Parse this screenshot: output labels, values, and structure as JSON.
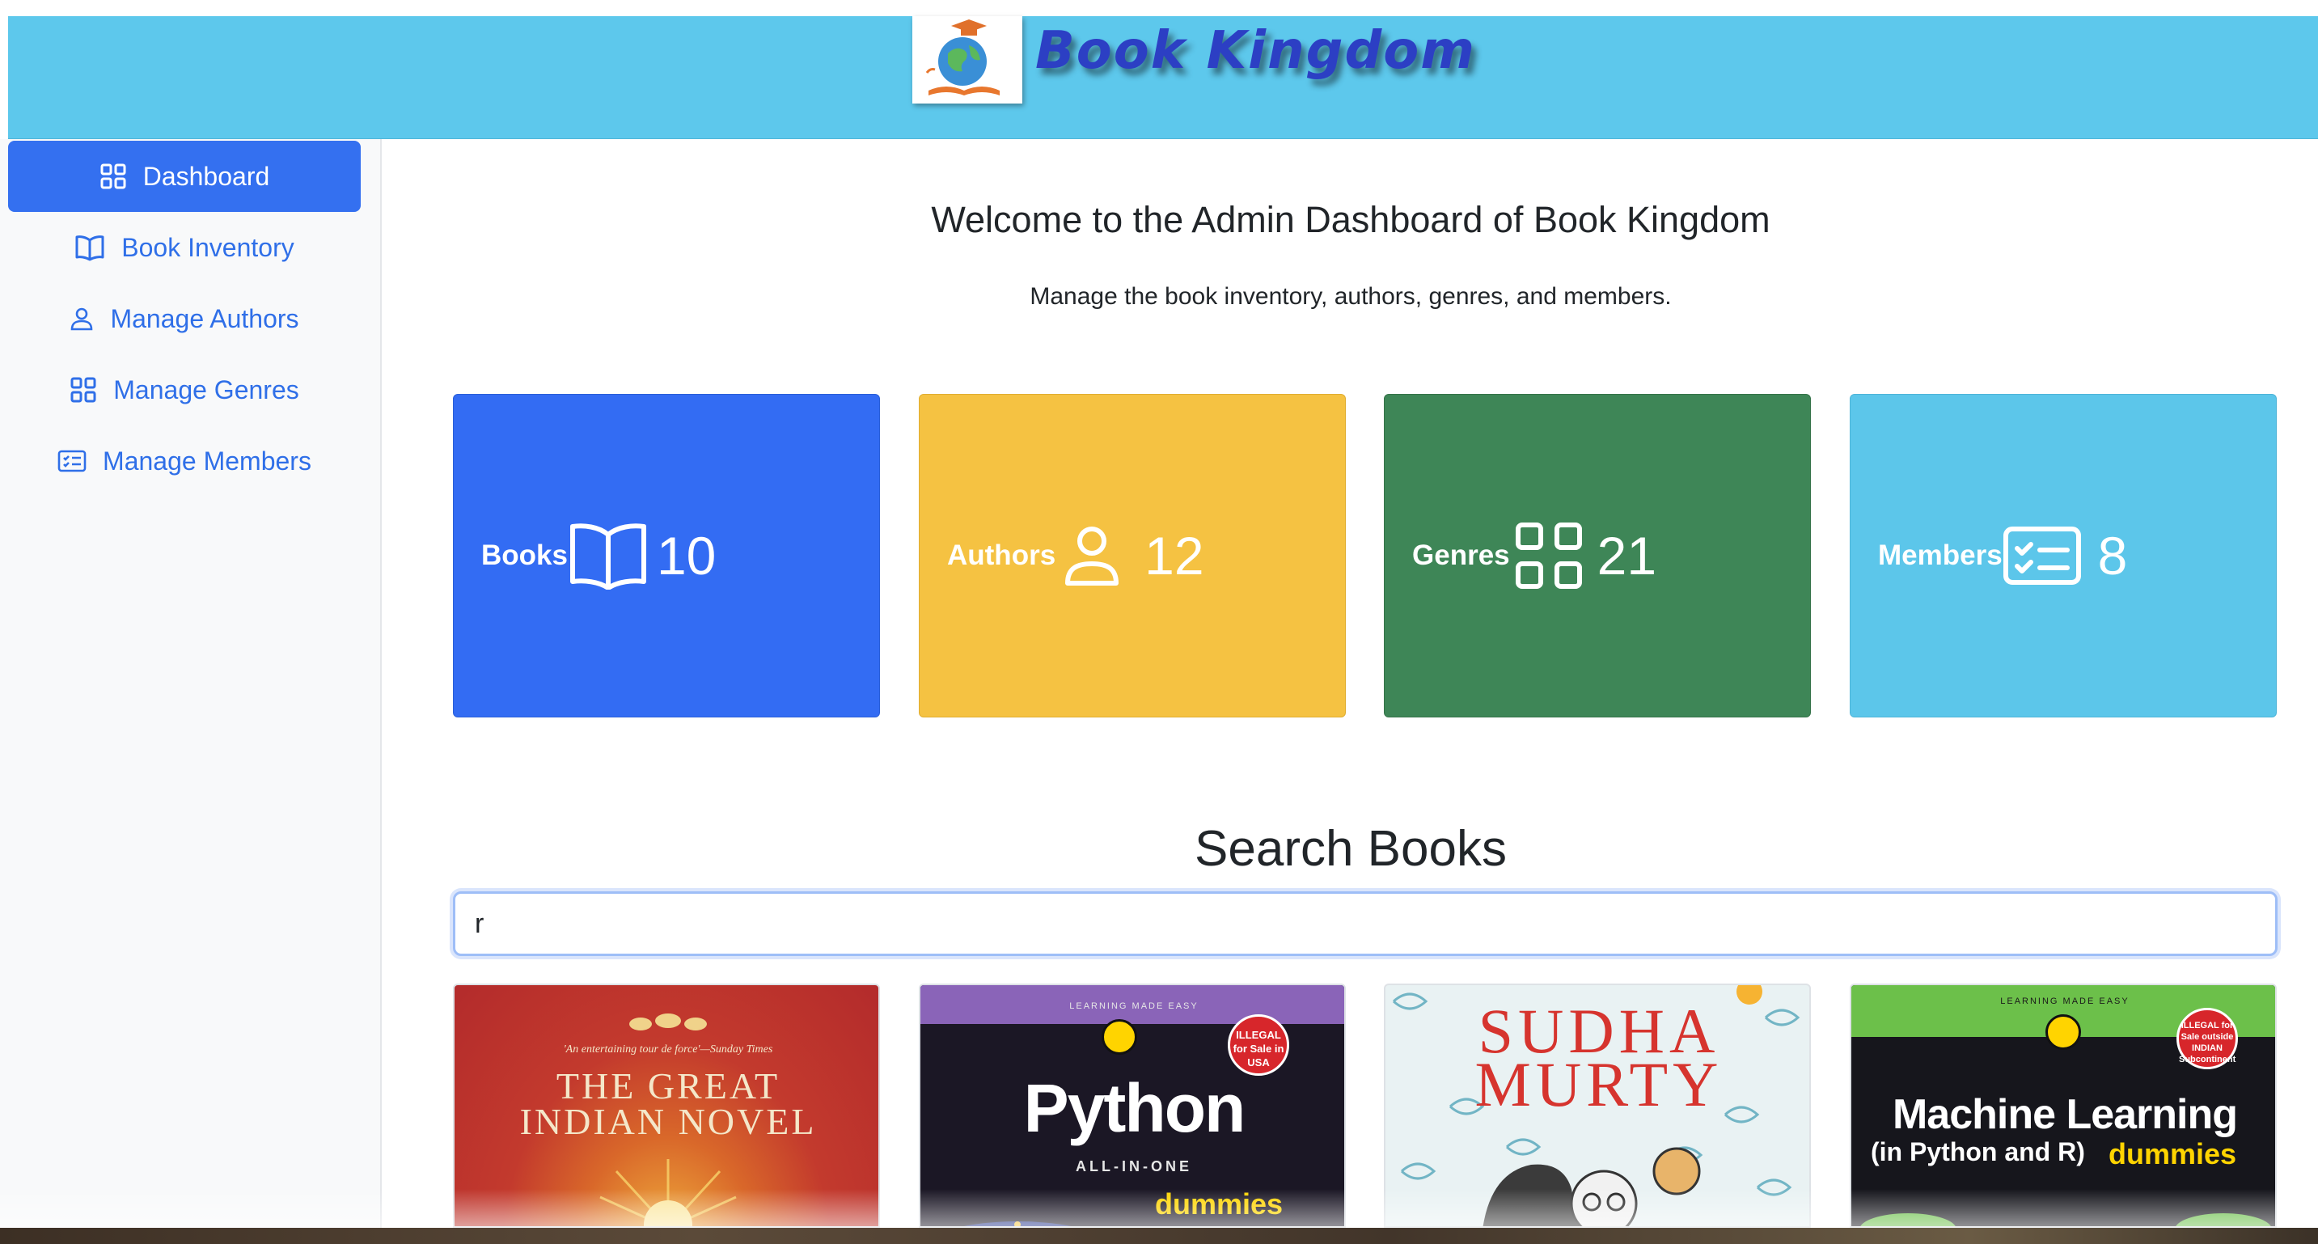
{
  "header": {
    "brand": "Book Kingdom"
  },
  "sidebar": {
    "items": [
      {
        "label": "Dashboard",
        "icon": "grid-icon",
        "active": true
      },
      {
        "label": "Book Inventory",
        "icon": "book-icon",
        "active": false
      },
      {
        "label": "Manage Authors",
        "icon": "person-icon",
        "active": false
      },
      {
        "label": "Manage Genres",
        "icon": "grid-icon",
        "active": false
      },
      {
        "label": "Manage Members",
        "icon": "card-list-icon",
        "active": false
      }
    ]
  },
  "main": {
    "welcome": "Welcome to the Admin Dashboard of Book Kingdom",
    "subtitle": "Manage the book inventory, authors, genres, and members.",
    "stats": [
      {
        "label": "Books",
        "value": "10",
        "icon": "book-icon",
        "color": "#336cf3"
      },
      {
        "label": "Authors",
        "value": "12",
        "icon": "person-icon",
        "color": "#f5c242"
      },
      {
        "label": "Genres",
        "value": "21",
        "icon": "grid-icon",
        "color": "#3e8657"
      },
      {
        "label": "Members",
        "value": "8",
        "icon": "card-list-icon",
        "color": "#5cc6ea"
      }
    ],
    "search": {
      "title": "Search Books",
      "value": "r"
    },
    "books": [
      {
        "cover_quote": "'An entertaining tour de force'—Sunday Times",
        "cover_title_1": "THE GREAT",
        "cover_title_2": "INDIAN NOVEL"
      },
      {
        "cover_kicker": "LEARNING MADE EASY",
        "cover_title": "Python",
        "cover_sub": "ALL-IN-ONE",
        "cover_brand": "dummies",
        "badge": "ILLEGAL for Sale in USA"
      },
      {
        "cover_title_1": "SUDHA",
        "cover_title_2": "MURTY"
      },
      {
        "cover_kicker": "LEARNING MADE EASY",
        "cover_title": "Machine Learning",
        "cover_sub": "(in Python and R)",
        "cover_brand": "dummies",
        "badge": "ILLEGAL for Sale outside INDIAN Subcontinent"
      }
    ]
  }
}
